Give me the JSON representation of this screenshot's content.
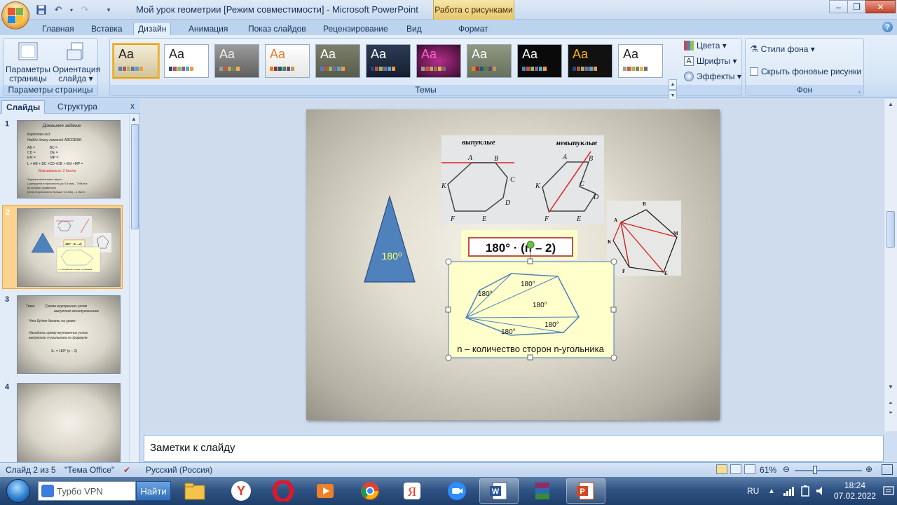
{
  "window": {
    "title": "Мой урок геометрии [Режим совместимости] - Microsoft PowerPoint",
    "context_tab_title": "Работа с рисунками"
  },
  "ribbon_tabs": [
    "Главная",
    "Вставка",
    "Дизайн",
    "Анимация",
    "Показ слайдов",
    "Рецензирование",
    "Вид",
    "Формат"
  ],
  "ribbon": {
    "page_setup": {
      "btn1": "Параметры страницы",
      "btn1_l1": "Параметры",
      "btn1_l2": "страницы",
      "btn2_l1": "Ориентация",
      "btn2_l2": "слайда ▾",
      "label": "Параметры страницы"
    },
    "themes": {
      "sample": "Aa",
      "label": "Темы"
    },
    "theme_side": {
      "colors": "Цвета ▾",
      "fonts": "Шрифты ▾",
      "effects": "Эффекты ▾"
    },
    "background": {
      "styles": "Стили фона ▾",
      "hide": "Скрыть фоновые рисунки",
      "label": "Фон"
    }
  },
  "slides_panel": {
    "tab_slides": "Слайды",
    "tab_outline": "Структура",
    "close": "x",
    "numbers": [
      "1",
      "2",
      "3",
      "4"
    ],
    "thumb1": {
      "title": "Домашнее задание",
      "l1": "Карточка №3",
      "l2": "Найди длину ломаной ABCDEMK.",
      "l3": "AB =               BC =",
      "l4": "CD =               DE =",
      "l5": "EM =               MP =",
      "l6": "L = AB + BC +CD +DE + EM +MP =",
      "l7": "Максимально:  3 балла",
      "l8": "Задание выполнено верно",
      "l9": "( допущена погрешность до 0,5 мм) – 3 балла,",
      "l10": "из которых правильно",
      "l11": "(если погрешность больше 0,5 мм) – 1 балл."
    },
    "thumb3": {
      "l1": "Тема:          Сумма внутренних углов",
      "l2": "выпуклого многоугольника",
      "l3": "Что будем делать на уроке:",
      "l4": "Находить сумму внутренних углов",
      "l5": "выпуклого n-угольника по формуле:",
      "l6": "Sₙ = 180⁰ (n – 2)"
    }
  },
  "slide": {
    "triangle_label": "180⁰",
    "header_convex": "выпуклые",
    "header_nonconvex": "невыпуклые",
    "convex_vertices": [
      "A",
      "B",
      "C",
      "D",
      "E",
      "F",
      "K"
    ],
    "nonconvex_vertices": [
      "A",
      "B",
      "C",
      "D",
      "E",
      "F",
      "K"
    ],
    "pent_vertices": [
      "B",
      "A",
      "M",
      "K",
      "F",
      "E"
    ],
    "formula": "180° · (n – 2)",
    "fan_angles": [
      "180°",
      "180°",
      "180°",
      "180°",
      "180°"
    ],
    "caption": "n – количество сторон n-угольника"
  },
  "notes_placeholder": "Заметки к слайду",
  "statusbar": {
    "slide_count": "Слайд 2 из 5",
    "theme": "\"Тема Office\"",
    "language": "Русский (Россия)",
    "zoom": "61%"
  },
  "taskbar": {
    "search_placeholder": "Турбо VPN",
    "search_button": "Найти",
    "lang": "RU",
    "time": "18:24",
    "date": "07.02.2022"
  },
  "colors": {
    "accent": "#4a7cbf",
    "triangle": "#4f81bd",
    "formula_border": "#c0504d",
    "caption_bg": "#ffffcc"
  }
}
